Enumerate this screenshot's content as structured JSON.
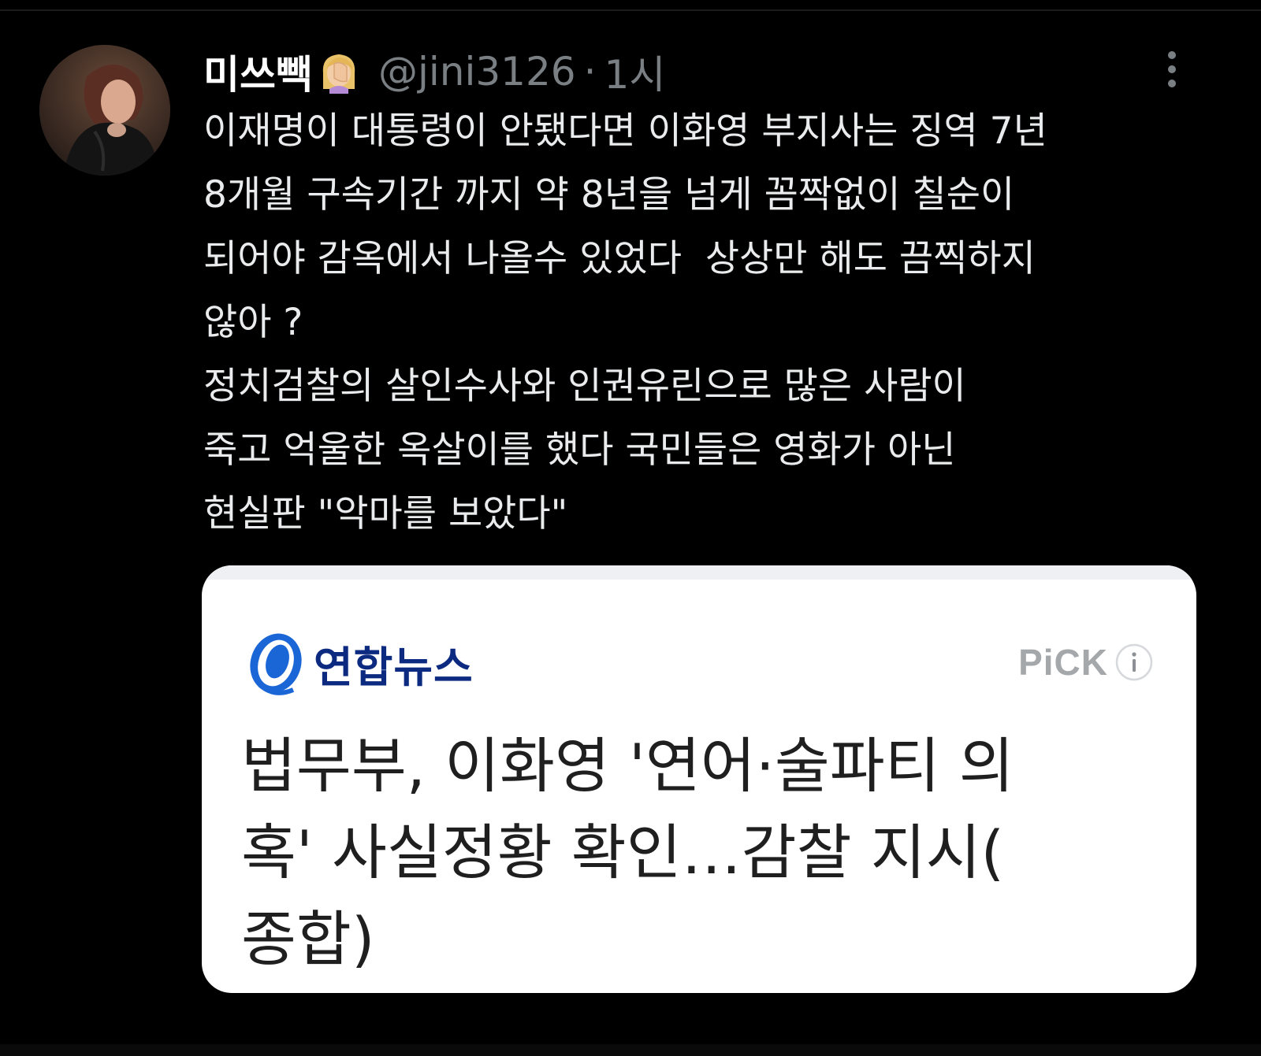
{
  "tweet": {
    "display_name": "미쓰빽",
    "emoji_icon": "person-facepalming-emoji",
    "handle": "@jini3126",
    "separator": "·",
    "timestamp": "1시",
    "more_icon": "more-vertical-icon",
    "text_lines": [
      "이재명이 대통령이 안됐다면 이화영 부지사는 징역 7년",
      "8개월 구속기간 까지 약 8년을 넘게 꼼짝없이 칠순이",
      "되어야 감옥에서 나올수 있었다  상상만 해도 끔찍하지",
      "않아 ?",
      "정치검찰의 살인수사와 인권유린으로 많은 사람이",
      "죽고 억울한 옥살이를 했다 국민들은 영화가 아닌",
      "현실판 \"악마를 보았다\""
    ]
  },
  "card": {
    "source_name": "연합뉴스",
    "source_logo_icon": "yonhap-news-logo-icon",
    "badge": "PiCK",
    "info_icon": "info-circle-icon",
    "headline_lines": [
      "법무부, 이화영 '연어·술파티 의",
      "혹' 사실정황 확인…감찰 지시(",
      "종합)"
    ]
  },
  "colors": {
    "background": "#000000",
    "text": "#e7e9ea",
    "muted": "#7a7f84",
    "card_background": "#ffffff",
    "news_brand": "#0c2a80",
    "logo_blue": "#1b66d6"
  }
}
